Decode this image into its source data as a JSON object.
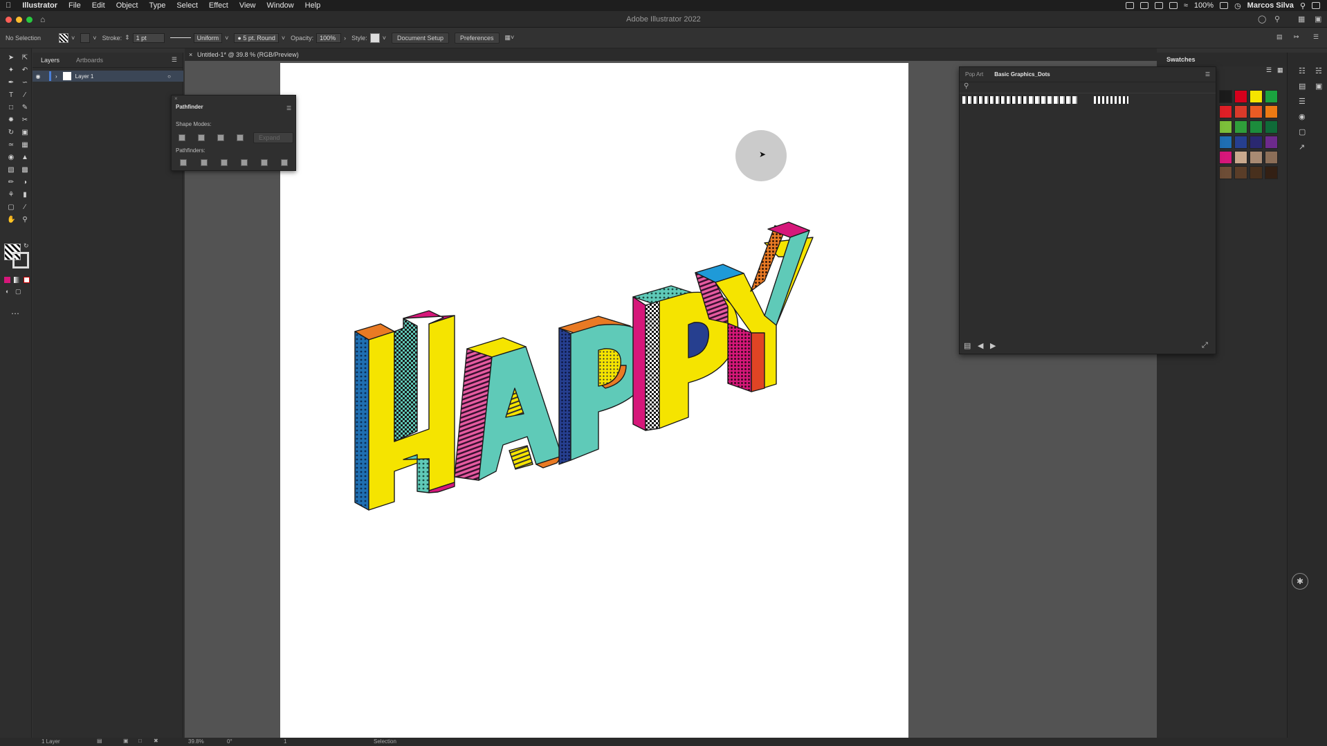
{
  "menubar": {
    "app": "Illustrator",
    "items": [
      "File",
      "Edit",
      "Object",
      "Type",
      "Select",
      "Effect",
      "View",
      "Window",
      "Help"
    ],
    "battery": "100%",
    "user": "Marcos Silva"
  },
  "window": {
    "title": "Adobe Illustrator 2022"
  },
  "controlbar": {
    "selection": "No Selection",
    "stroke_label": "Stroke:",
    "stroke_value": "1 pt",
    "stroke_profile": "Uniform",
    "brush": "5 pt. Round",
    "opacity_label": "Opacity:",
    "opacity_value": "100%",
    "style_label": "Style:",
    "document_setup": "Document Setup",
    "preferences": "Preferences"
  },
  "layers_panel": {
    "tabs": [
      "Layers",
      "Artboards"
    ],
    "layer_name": "Layer 1",
    "footer": "1 Layer"
  },
  "document": {
    "tab": "Untitled-1* @ 39.8 % (RGB/Preview)"
  },
  "pathfinder": {
    "title": "Pathfinder",
    "shape_modes": "Shape Modes:",
    "expand": "Expand",
    "pathfinders": "Pathfinders:"
  },
  "swatches": {
    "title": "Swatches",
    "tabs": [
      "Pop Art",
      "Basic Graphics_Dots"
    ],
    "colors": [
      "#1b1b1b",
      "#d6001c",
      "#f5e400",
      "#1aa33f",
      "#e01f26",
      "#d93a2a",
      "#ea5b24",
      "#ec7a14",
      "#7cbf3a",
      "#2f9e3a",
      "#1c8c3c",
      "#0f6a38",
      "#1f6fb2",
      "#263f8f",
      "#2a2870",
      "#6d2a8c",
      "#d6177a",
      "#c9a98e",
      "#a88a73",
      "#8b6e58",
      "#6d4d36",
      "#5a3d28",
      "#48301d",
      "#332014"
    ]
  },
  "statusbar": {
    "zoom": "39.8%",
    "rotation": "0°",
    "artboard": "1",
    "tool": "Selection"
  }
}
